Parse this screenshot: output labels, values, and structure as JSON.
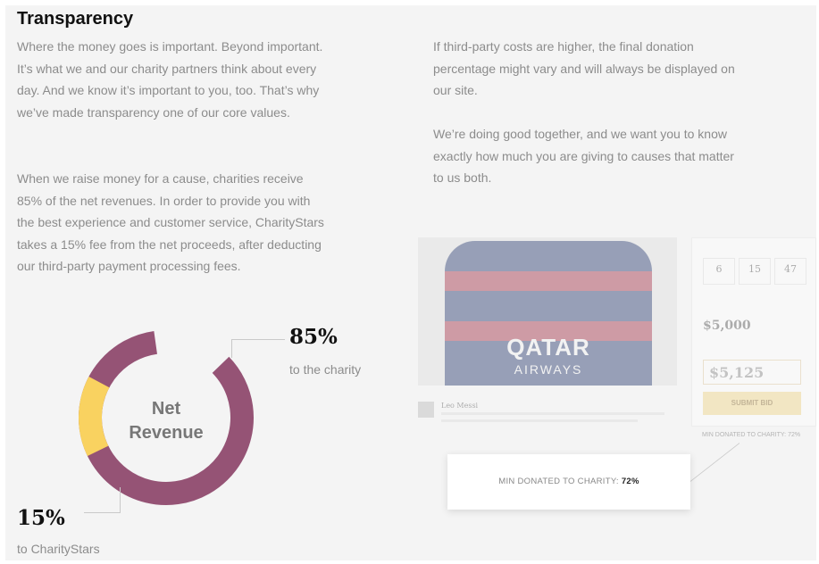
{
  "title": "Transparency",
  "left_paragraphs": [
    "Where the money goes is important. Beyond important. It’s what we and our charity partners think about every day. And we know it’s important to you, too. That’s why we’ve made transparency one of our core values.",
    "When we raise money for a cause, charities receive 85% of the net revenues. In order to provide you with the best experience and customer service, CharityStars takes a 15% fee from the net proceeds, after deducting our third-party payment processing fees."
  ],
  "right_paragraphs": [
    "If third-party costs are higher, the final donation percentage might vary and will always be displayed on our site.",
    "We’re doing good together, and we want you to know exactly how much you are giving to causes that matter to us both."
  ],
  "chart_data": {
    "type": "pie",
    "center_label": "Net Revenue",
    "slices": [
      {
        "value": 85,
        "display": "85%",
        "label": "to the charity",
        "color": "#955375"
      },
      {
        "value": 15,
        "display": "15%",
        "label": "to CharityStars",
        "color": "#f9d260"
      }
    ]
  },
  "mockup": {
    "jersey_text": "QATAR",
    "jersey_text2": "AIRWAYS",
    "countdown": [
      "6",
      "15",
      "47"
    ],
    "current_bid": "$5,000",
    "bid_input": "$5,125",
    "submit_label": "SUBMIT BID",
    "comment_author": "Leo Messi",
    "min_donated_small": "MIN DONATED TO CHARITY: 72%"
  },
  "callout": {
    "label": "MIN DONATED TO CHARITY:",
    "value": "72%"
  },
  "colors": {
    "charity": "#955375",
    "charitystars": "#f9d260",
    "panel_bg": "#f4f4f4"
  }
}
